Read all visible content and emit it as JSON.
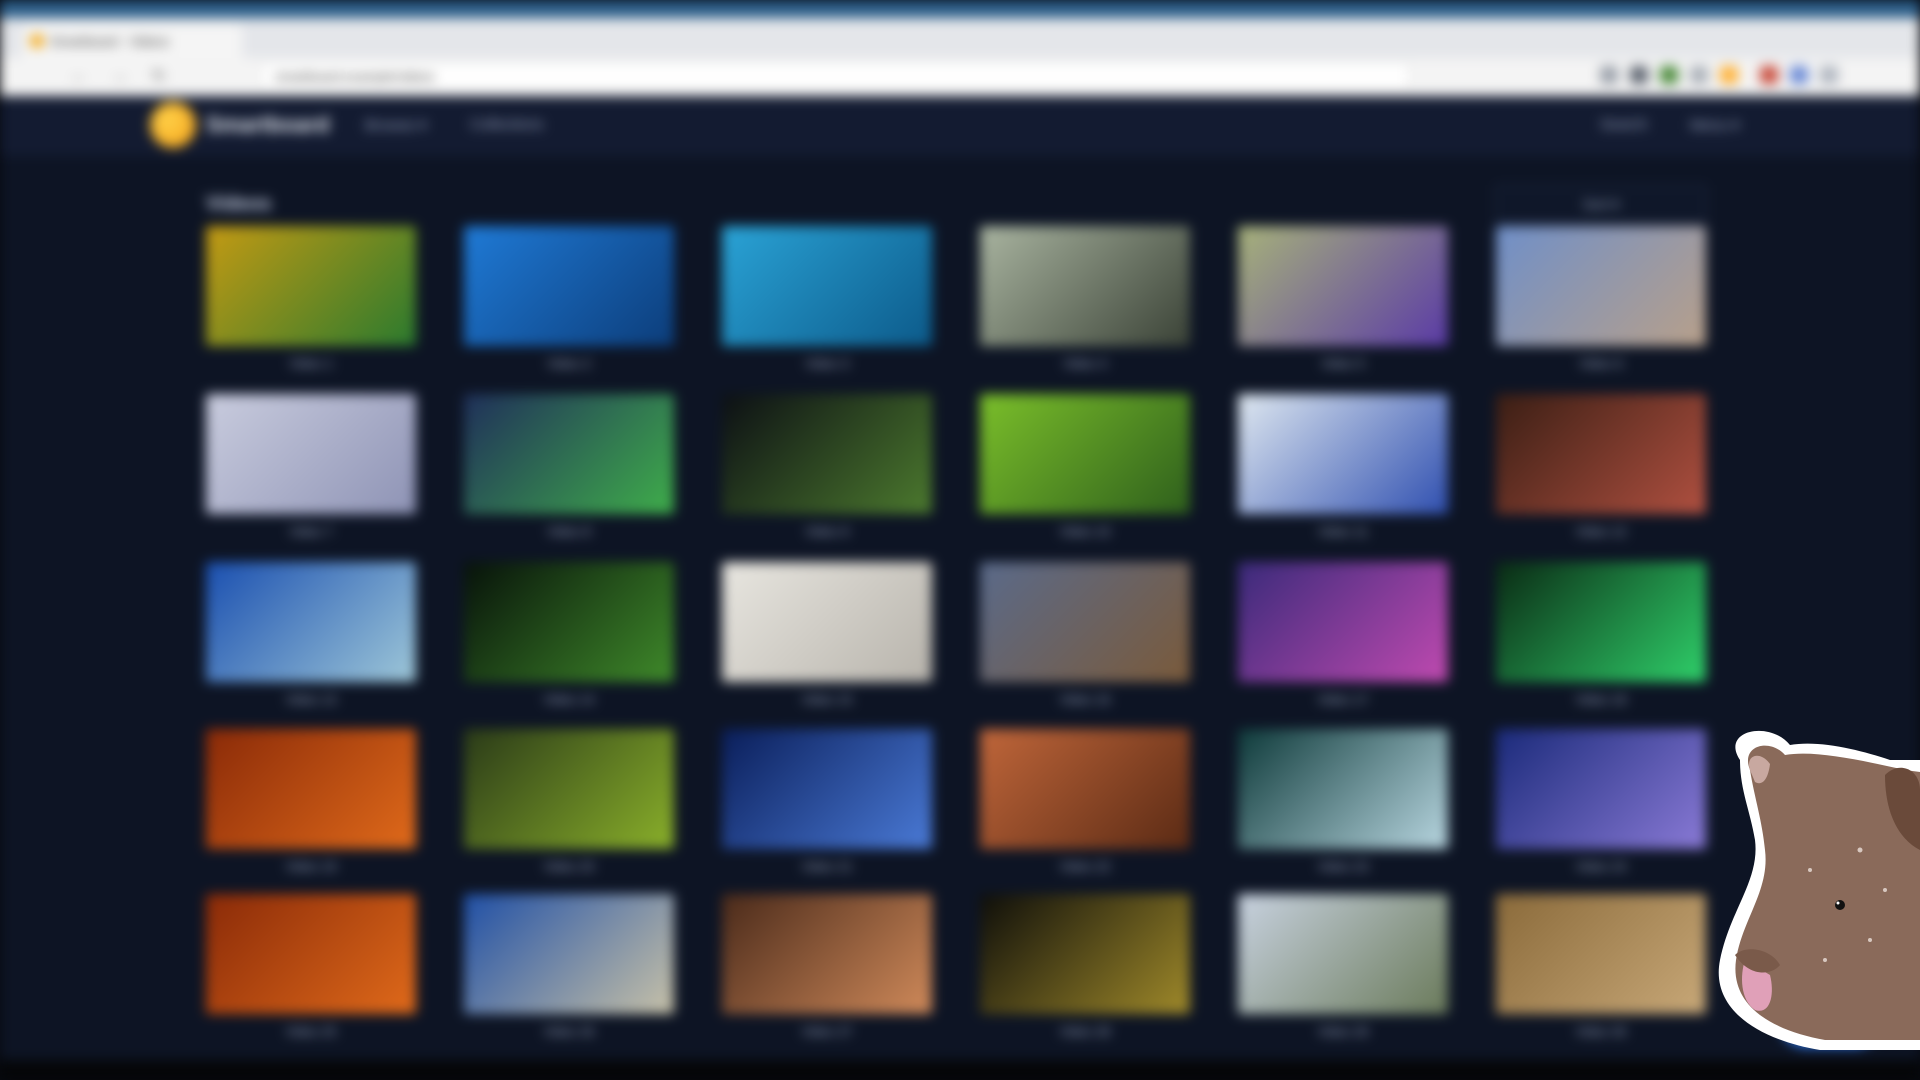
{
  "browser": {
    "tab_title": "Smartboard - Videos",
    "url": "smartboard.example/videos",
    "back_icon": "arrow-left-icon",
    "forward_icon": "arrow-right-icon",
    "reload_icon": "reload-icon"
  },
  "app": {
    "logo_text": "Smartboard",
    "nav": [
      "Browse ▾",
      "Collections"
    ],
    "nav_right": [
      "Search",
      "Menu ▾"
    ],
    "section_title": "Videos",
    "filter_label": "Sort ▾",
    "fab_color": "#2f7df6"
  },
  "videos": [
    {
      "title": "Video 1",
      "color_a": "#c49a13",
      "color_b": "#2a7a2e"
    },
    {
      "title": "Video 2",
      "color_a": "#1f7ad6",
      "color_b": "#0c3d7a"
    },
    {
      "title": "Video 3",
      "color_a": "#2aa3d6",
      "color_b": "#0c5a8a"
    },
    {
      "title": "Video 4",
      "color_a": "#a9b4a0",
      "color_b": "#3a4236"
    },
    {
      "title": "Video 5",
      "color_a": "#a7b27a",
      "color_b": "#5a3aa6"
    },
    {
      "title": "Video 6",
      "color_a": "#6f8fc8",
      "color_b": "#b8a08a"
    },
    {
      "title": "Video 7",
      "color_a": "#c9ccde",
      "color_b": "#8e93b5"
    },
    {
      "title": "Video 8",
      "color_a": "#1f2f5a",
      "color_b": "#3fae4a"
    },
    {
      "title": "Video 9",
      "color_a": "#0c0f14",
      "color_b": "#4c7a2e"
    },
    {
      "title": "Video 10",
      "color_a": "#7bbf2a",
      "color_b": "#2e5f1c"
    },
    {
      "title": "Video 11",
      "color_a": "#dfe8f0",
      "color_b": "#2f4fb0"
    },
    {
      "title": "Video 12",
      "color_a": "#3a1e14",
      "color_b": "#b05040"
    },
    {
      "title": "Video 13",
      "color_a": "#1a4fb0",
      "color_b": "#9ec7d8"
    },
    {
      "title": "Video 14",
      "color_a": "#07120a",
      "color_b": "#3f8a2a"
    },
    {
      "title": "Video 15",
      "color_a": "#e8e6e0",
      "color_b": "#b7b3ab"
    },
    {
      "title": "Video 16",
      "color_a": "#5a6a8a",
      "color_b": "#7a5a3a"
    },
    {
      "title": "Video 17",
      "color_a": "#3a2a7a",
      "color_b": "#c04ab0"
    },
    {
      "title": "Video 18",
      "color_a": "#0a2a14",
      "color_b": "#2fd06a"
    },
    {
      "title": "Video 19",
      "color_a": "#8a2a08",
      "color_b": "#e06a1a"
    },
    {
      "title": "Video 20",
      "color_a": "#2a3a18",
      "color_b": "#8ab02a"
    },
    {
      "title": "Video 21",
      "color_a": "#0a1e5a",
      "color_b": "#4a7ad6"
    },
    {
      "title": "Video 22",
      "color_a": "#c0663a",
      "color_b": "#5a2a14"
    },
    {
      "title": "Video 23",
      "color_a": "#0e3a3a",
      "color_b": "#b8d6e0"
    },
    {
      "title": "Video 24",
      "color_a": "#1a2a7a",
      "color_b": "#8a7ad6"
    },
    {
      "title": "Video 25",
      "color_a": "#8a2a08",
      "color_b": "#e06a1a"
    },
    {
      "title": "Video 26",
      "color_a": "#1f4fa6",
      "color_b": "#c8c2a8"
    },
    {
      "title": "Video 27",
      "color_a": "#4a2a1a",
      "color_b": "#d08a5a"
    },
    {
      "title": "Video 28",
      "color_a": "#0e0e0a",
      "color_b": "#a08a2a"
    },
    {
      "title": "Video 29",
      "color_a": "#c8d2e0",
      "color_b": "#6a7a5a"
    },
    {
      "title": "Video 30",
      "color_a": "#8a6a3a",
      "color_b": "#c8a878"
    }
  ]
}
